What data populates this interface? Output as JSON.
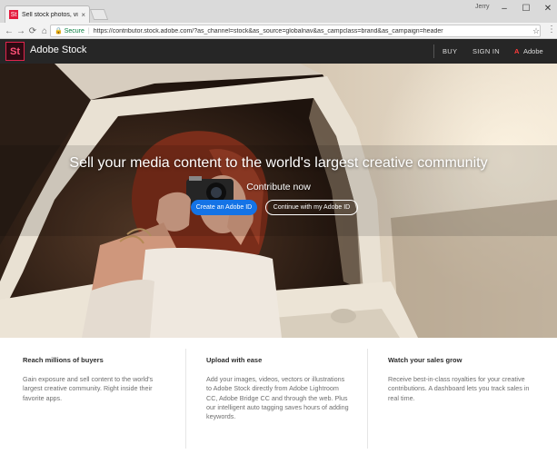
{
  "browser": {
    "tab_title": "Sell stock photos, video...",
    "tab_close": "×",
    "favicon": "St",
    "user": "Jerry",
    "window_controls": {
      "minimize": "–",
      "maximize": "☐",
      "close": "✕"
    },
    "nav": {
      "back": "←",
      "forward": "→",
      "reload": "⟳",
      "home": "⌂"
    },
    "secure_label": "Secure",
    "url": "https://contributor.stock.adobe.com/?as_channel=stock&as_source=globalnav&as_campclass=brand&as_campaign=header"
  },
  "header": {
    "logo_text": "St",
    "brand": "Adobe Stock",
    "links": {
      "buy": "BUY",
      "sign_in": "SIGN IN",
      "adobe": "Adobe"
    },
    "adobe_mark": "A"
  },
  "hero": {
    "title": "Sell your media content to the world's largest creative community",
    "subtitle": "Contribute now",
    "primary_button": "Create an Adobe ID",
    "secondary_button": "Continue with my Adobe ID"
  },
  "features": [
    {
      "title": "Reach millions of buyers",
      "body": "Gain exposure and sell content to the world's largest creative community. Right inside their favorite apps."
    },
    {
      "title": "Upload with ease",
      "body": "Add your images, videos, vectors or illustrations to Adobe Stock directly from Adobe Lightroom CC, Adobe Bridge CC and through the web. Plus our intelligent auto tagging saves hours of adding keywords."
    },
    {
      "title": "Watch your sales grow",
      "body": "Receive best-in-class royalties for your creative contributions. A dashboard lets you track sales in real time."
    }
  ],
  "colors": {
    "brand_accent": "#e0244c",
    "primary_button": "#1473e6",
    "header_bg": "#262626"
  }
}
